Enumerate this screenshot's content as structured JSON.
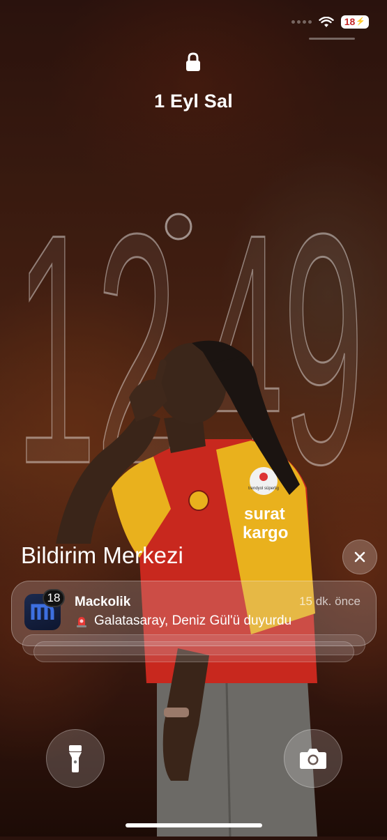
{
  "status": {
    "battery_level": "18",
    "battery_charging": true,
    "wifi": "wifi-icon"
  },
  "lock_screen": {
    "date": "1 Eyl Sal",
    "time_hours": "12",
    "time_minutes": "49",
    "lock_icon": "lock-icon"
  },
  "notification_center": {
    "title": "Bildirim Merkezi",
    "close_icon": "close-icon",
    "notifications": [
      {
        "app": "Mackolik",
        "badge": "18",
        "time": "15 dk. önce",
        "icon": "siren-icon",
        "text": "Galatasaray, Deniz Gül'ü duyurdu"
      }
    ]
  },
  "controls": {
    "flashlight": "flashlight-icon",
    "camera": "camera-icon"
  },
  "wallpaper_text": {
    "sponsor_1": "surat",
    "sponsor_2": "kargo",
    "league": "trendyol süperlig"
  },
  "colors": {
    "battery_low": "#c62828",
    "jersey_red": "#c8281e",
    "jersey_yellow": "#e9b11d"
  }
}
